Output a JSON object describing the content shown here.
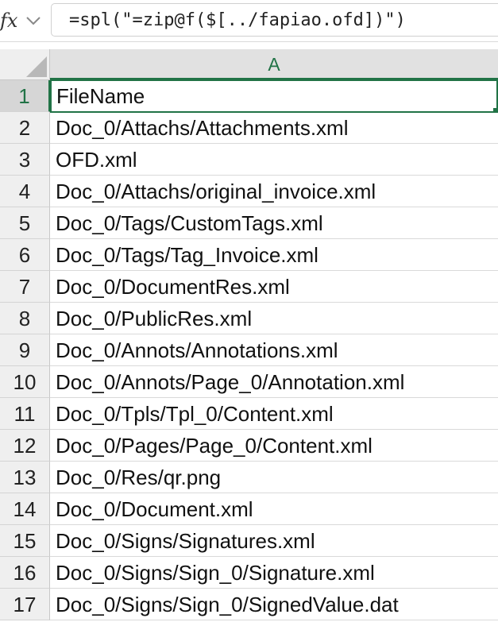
{
  "formula_bar": {
    "fx_label": "fx",
    "formula": "=spl(\"=zip@f($[../fapiao.ofd])\")"
  },
  "column_headers": [
    "A"
  ],
  "rows": [
    {
      "num": "1",
      "value": "FileName"
    },
    {
      "num": "2",
      "value": "Doc_0/Attachs/Attachments.xml"
    },
    {
      "num": "3",
      "value": "OFD.xml"
    },
    {
      "num": "4",
      "value": "Doc_0/Attachs/original_invoice.xml"
    },
    {
      "num": "5",
      "value": "Doc_0/Tags/CustomTags.xml"
    },
    {
      "num": "6",
      "value": "Doc_0/Tags/Tag_Invoice.xml"
    },
    {
      "num": "7",
      "value": "Doc_0/DocumentRes.xml"
    },
    {
      "num": "8",
      "value": "Doc_0/PublicRes.xml"
    },
    {
      "num": "9",
      "value": "Doc_0/Annots/Annotations.xml"
    },
    {
      "num": "10",
      "value": "Doc_0/Annots/Page_0/Annotation.xml"
    },
    {
      "num": "11",
      "value": "Doc_0/Tpls/Tpl_0/Content.xml"
    },
    {
      "num": "12",
      "value": "Doc_0/Pages/Page_0/Content.xml"
    },
    {
      "num": "13",
      "value": "Doc_0/Res/qr.png"
    },
    {
      "num": "14",
      "value": "Doc_0/Document.xml"
    },
    {
      "num": "15",
      "value": "Doc_0/Signs/Signatures.xml"
    },
    {
      "num": "16",
      "value": "Doc_0/Signs/Sign_0/Signature.xml"
    },
    {
      "num": "17",
      "value": "Doc_0/Signs/Sign_0/SignedValue.dat"
    }
  ],
  "selected_row": "1",
  "colors": {
    "accent": "#217346",
    "header_bg": "#e1e1e1"
  },
  "icons": {
    "fx": "fx-icon",
    "dropdown": "chevron-down-icon"
  }
}
